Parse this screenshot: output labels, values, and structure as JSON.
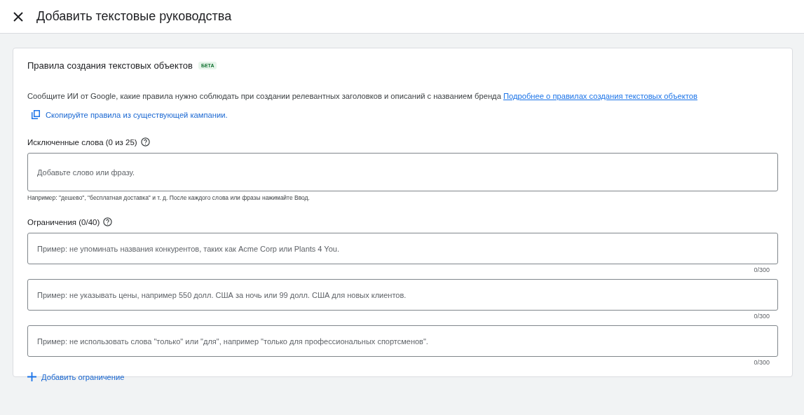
{
  "header": {
    "title": "Добавить текстовые руководства"
  },
  "card": {
    "title": "Правила создания текстовых объектов",
    "badge": "БЕТА",
    "description": "Сообщите ИИ от Google, какие правила нужно соблюдать при создании релевантных заголовков и описаний с названием бренда",
    "description_link": "Подробнее о правилах создания текстовых объектов",
    "copy_link": "Скопируйте правила из существующей кампании.",
    "excluded": {
      "label": "Исключенные слова (0 из 25)",
      "placeholder": "Добавьте слово или фразу.",
      "hint": "Например: \"дешево\", \"бесплатная доставка\" и т. д. После каждого слова или фразы нажимайте Ввод."
    },
    "restrictions": {
      "label": "Ограничения (0/40)",
      "fields": [
        {
          "placeholder": "Пример: не упоминать названия конкурентов, таких как Acme Corp или Plants 4 You.",
          "counter": "0/300"
        },
        {
          "placeholder": "Пример: не указывать цены, например 550 долл. США за ночь или 99 долл. США для новых клиентов.",
          "counter": "0/300"
        },
        {
          "placeholder": "Пример: не использовать слова \"только\" или \"для\", например \"только для профессиональных спортсменов\".",
          "counter": "0/300"
        }
      ]
    },
    "add_button": "Добавить ограничение"
  }
}
